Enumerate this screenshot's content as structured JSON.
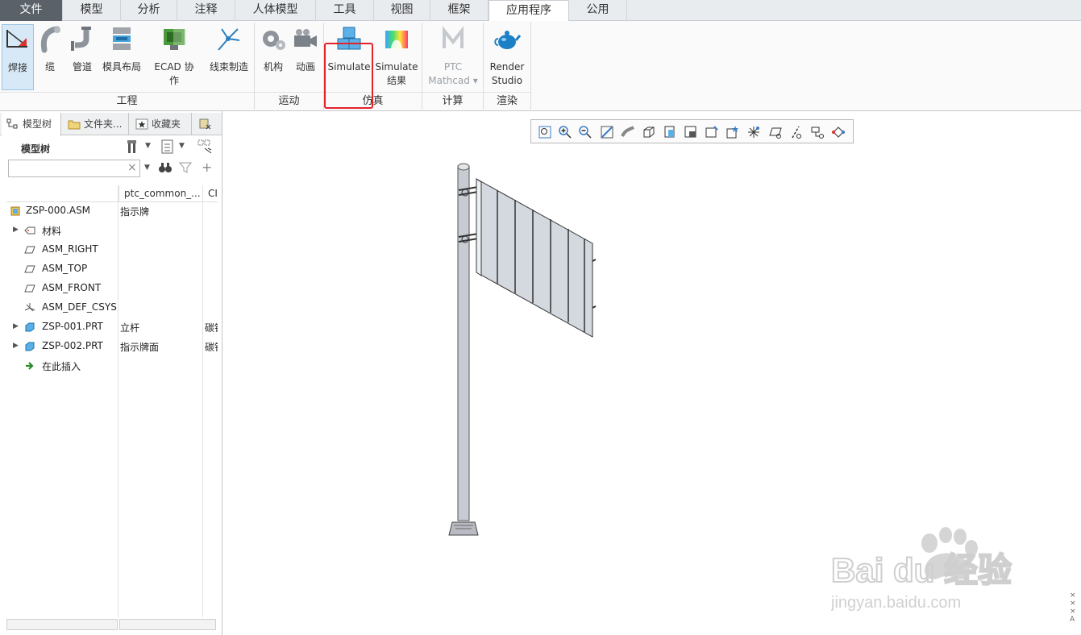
{
  "menu": {
    "tabs": [
      "文件",
      "模型",
      "分析",
      "注释",
      "人体模型",
      "工具",
      "视图",
      "框架",
      "应用程序",
      "公用"
    ],
    "active": "应用程序"
  },
  "ribbon": {
    "buttons": {
      "weld": "焊接",
      "cable": "缆",
      "piping": "管道",
      "mold_layout": "模具布局",
      "ecad_line1": "ECAD 协",
      "ecad_line2": "作",
      "harness": "线束制造",
      "mechanism": "机构",
      "animation": "动画",
      "simulate": "Simulate",
      "sim_results_line1": "Simulate",
      "sim_results_line2": "结果",
      "mathcad_line1": "PTC",
      "mathcad_line2": "Mathcad",
      "render_line1": "Render",
      "render_line2": "Studio"
    },
    "groups": {
      "engineering": "工程",
      "motion": "运动",
      "simulation": "仿真",
      "compute": "计算",
      "render": "渲染"
    }
  },
  "panel": {
    "tabs": [
      "模型树",
      "文件夹...",
      "收藏夹"
    ],
    "tree_title": "模型树",
    "search_value": "",
    "columns": [
      "ptc_common_...",
      "CI"
    ],
    "rows": [
      {
        "name": "ZSP-000.ASM",
        "col1": "指示牌",
        "col2": ""
      },
      {
        "name": "材料",
        "col1": "",
        "col2": ""
      },
      {
        "name": "ASM_RIGHT",
        "col1": "",
        "col2": ""
      },
      {
        "name": "ASM_TOP",
        "col1": "",
        "col2": ""
      },
      {
        "name": "ASM_FRONT",
        "col1": "",
        "col2": ""
      },
      {
        "name": "ASM_DEF_CSYS",
        "col1": "",
        "col2": ""
      },
      {
        "name": "ZSP-001.PRT",
        "col1": "立杆",
        "col2": "碳钢"
      },
      {
        "name": "ZSP-002.PRT",
        "col1": "指示牌面",
        "col2": "碳钢"
      },
      {
        "name": "在此插入",
        "col1": "",
        "col2": ""
      }
    ]
  },
  "watermark": {
    "brand": "Bai du 经验",
    "url": "jingyan.baidu.com"
  },
  "colors": {
    "highlight": "#e3222b",
    "selected_bg": "#d7e9f7",
    "file_tab": "#5b6169",
    "model_gray": "#c8ccd2"
  }
}
